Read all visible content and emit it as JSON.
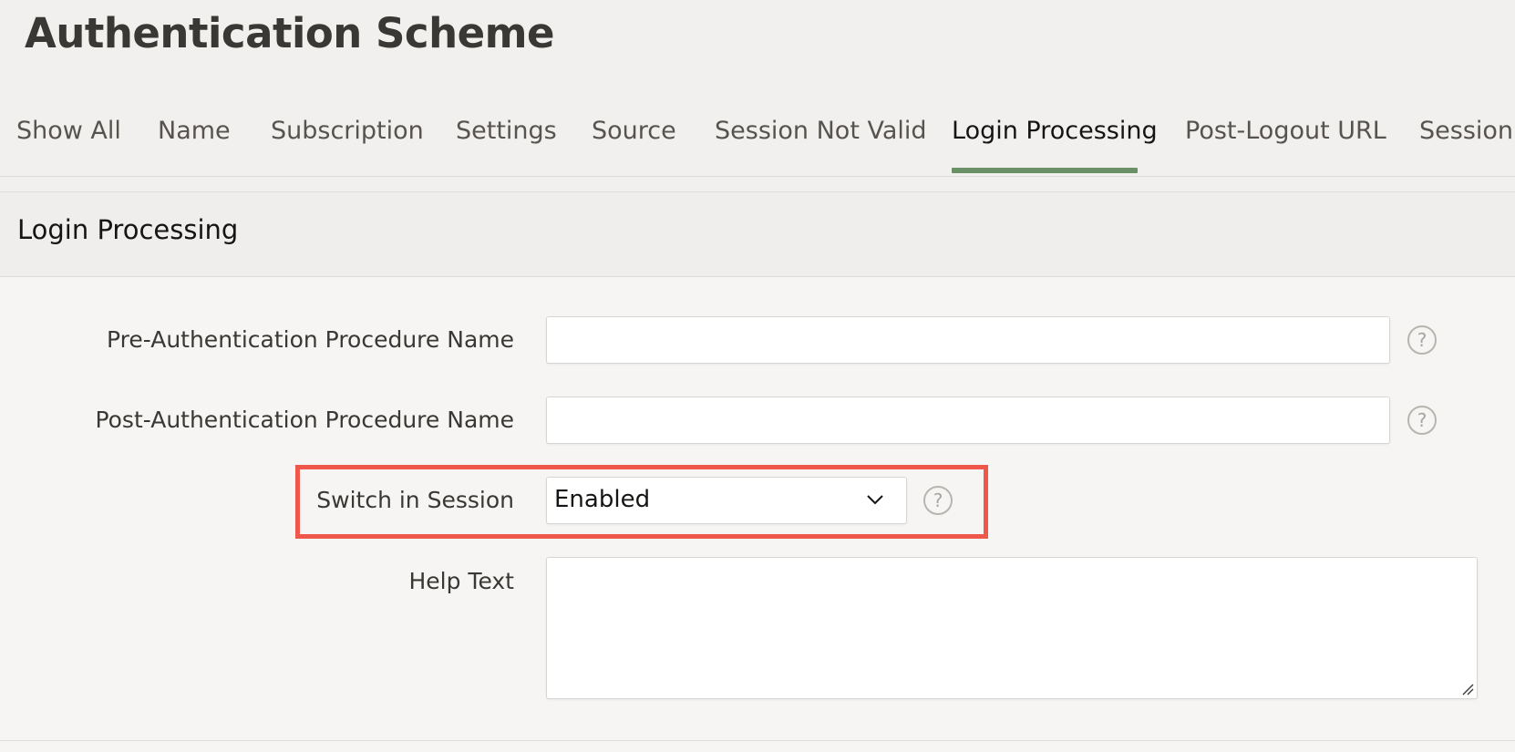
{
  "page": {
    "title": "Authentication Scheme"
  },
  "tabs": [
    {
      "label": "Show All",
      "active": false
    },
    {
      "label": "Name",
      "active": false
    },
    {
      "label": "Subscription",
      "active": false
    },
    {
      "label": "Settings",
      "active": false
    },
    {
      "label": "Source",
      "active": false
    },
    {
      "label": "Session Not Valid",
      "active": false
    },
    {
      "label": "Login Processing",
      "active": true
    },
    {
      "label": "Post-Logout URL",
      "active": false
    },
    {
      "label": "Session Sharing",
      "active": false
    }
  ],
  "region": {
    "title": "Login Processing"
  },
  "fields": {
    "pre_auth": {
      "label": "Pre-Authentication Procedure Name",
      "value": ""
    },
    "post_auth": {
      "label": "Post-Authentication Procedure Name",
      "value": ""
    },
    "switch_in_session": {
      "label": "Switch in Session",
      "value": "Enabled"
    },
    "help_text": {
      "label": "Help Text",
      "value": ""
    }
  },
  "help_icon_glyph": "?",
  "colors": {
    "active_tab_indicator": "#6a9165",
    "highlight_border": "#f0574b"
  }
}
